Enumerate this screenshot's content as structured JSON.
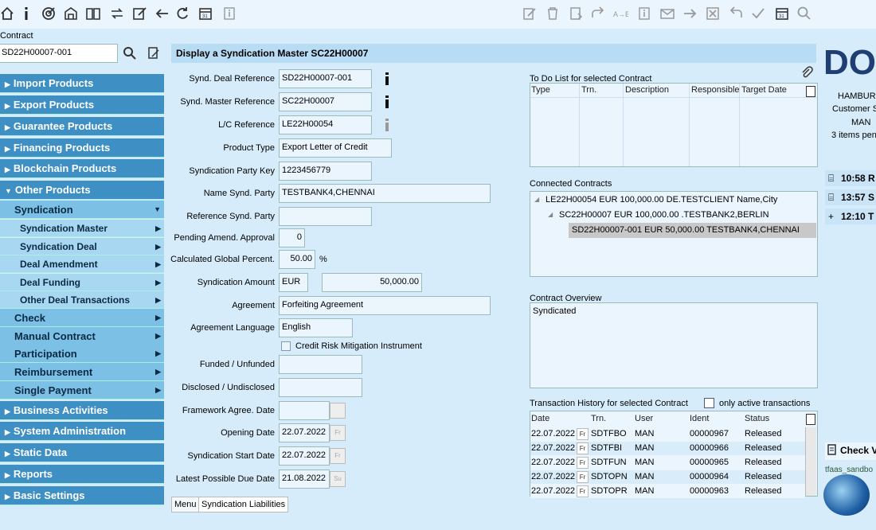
{
  "toolbar": {
    "left_icons": [
      "home-icon",
      "info-icon",
      "target-icon",
      "products-icon",
      "book-icon",
      "transfer-icon",
      "edit-icon",
      "back-arrow-icon",
      "refresh-icon",
      "calendar-icon",
      "info-box-icon"
    ],
    "right_icons": [
      "edit-doc-icon",
      "trash-icon",
      "attach-doc-icon",
      "forward-icon",
      "ab-icon",
      "info-box-icon",
      "mail-icon",
      "arrow-right-icon",
      "close-box-icon",
      "undo-icon",
      "check-icon",
      "calendar-icon",
      "search-icon"
    ]
  },
  "contract": {
    "label": "Contract",
    "value": "SD22H00007-001"
  },
  "nav": [
    {
      "label": "Import Products",
      "level": 0
    },
    {
      "label": "Export Products",
      "level": 0
    },
    {
      "label": "Guarantee Products",
      "level": 0
    },
    {
      "label": "Financing Products",
      "level": 0
    },
    {
      "label": "Blockchain Products",
      "level": 0
    },
    {
      "label": "Other Products",
      "level": 0,
      "open": true
    },
    {
      "label": "Syndication",
      "level": 1,
      "open": true
    },
    {
      "label": "Syndication Master",
      "level": 2
    },
    {
      "label": "Syndication Deal",
      "level": 2
    },
    {
      "label": "Deal Amendment",
      "level": 2
    },
    {
      "label": "Deal Funding",
      "level": 2
    },
    {
      "label": "Other Deal Transactions",
      "level": 2
    },
    {
      "label": "Check",
      "level": 1
    },
    {
      "label": "Manual Contract",
      "level": 1
    },
    {
      "label": "Participation",
      "level": 1
    },
    {
      "label": "Reimbursement",
      "level": 1
    },
    {
      "label": "Single Payment",
      "level": 1
    },
    {
      "label": "Business Activities",
      "level": 0
    },
    {
      "label": "System Administration",
      "level": 0
    },
    {
      "label": "Static Data",
      "level": 0
    },
    {
      "label": "Reports",
      "level": 0
    },
    {
      "label": "Basic Settings",
      "level": 0
    }
  ],
  "title": "Display a Syndication Master SC22H00007",
  "form": {
    "synd_deal_ref": {
      "label": "Synd. Deal Reference",
      "value": "SD22H00007-001"
    },
    "synd_master_ref": {
      "label": "Synd. Master Reference",
      "value": "SC22H00007"
    },
    "lc_ref": {
      "label": "L/C Reference",
      "value": "LE22H00054"
    },
    "product_type": {
      "label": "Product Type",
      "value": "Export Letter of Credit"
    },
    "party_key": {
      "label": "Syndication Party Key",
      "value": "1223456779"
    },
    "party_name": {
      "label": "Name Synd. Party",
      "value": "TESTBANK4,CHENNAI"
    },
    "reference": {
      "label": "Reference Synd. Party",
      "value": ""
    },
    "pending": {
      "label": "Pending Amend. Approval",
      "value": "0"
    },
    "percent": {
      "label": "Calculated Global Percent.",
      "value": "50.00",
      "unit": "%"
    },
    "amount": {
      "label": "Syndication Amount",
      "currency": "EUR",
      "value": "50,000.00"
    },
    "agreement": {
      "label": "Agreement",
      "value": "Forfeiting Agreement"
    },
    "language": {
      "label": "Agreement Language",
      "value": "English"
    },
    "crm": {
      "label": "Credit Risk Mitigation Instrument"
    },
    "funded": {
      "label": "Funded / Unfunded",
      "value": ""
    },
    "disclosed": {
      "label": "Disclosed / Undisclosed",
      "value": ""
    },
    "framework": {
      "label": "Framework Agree. Date",
      "value": ""
    },
    "opening": {
      "label": "Opening Date",
      "value": "22.07.2022",
      "cal": "Fr"
    },
    "start": {
      "label": "Syndication Start Date",
      "value": "22.07.2022",
      "cal": "Fr"
    },
    "due": {
      "label": "Latest Possible Due Date",
      "value": "21.08.2022",
      "cal": "Su"
    }
  },
  "todo": {
    "title": "To Do List for selected Contract",
    "columns": [
      "Type",
      "Trn.",
      "Description",
      "Responsible",
      "Target Date"
    ]
  },
  "connected": {
    "title": "Connected Contracts",
    "items": [
      "LE22H00054 EUR 100,000.00 DE.TESTCLIENT Name,City",
      "SC22H00007 EUR 100,000.00 .TESTBANK2,BERLIN",
      "SD22H00007-001 EUR 50,000.00 TESTBANK4,CHENNAI"
    ]
  },
  "overview": {
    "title": "Contract Overview",
    "text": "Syndicated"
  },
  "history": {
    "title": "Transaction History for selected Contract",
    "only_active": "only active transactions",
    "columns": [
      "Date",
      "Trn.",
      "User",
      "Ident",
      "Status"
    ],
    "rows": [
      {
        "date": "22.07.2022",
        "day": "Fr",
        "trn": "SDTFBO",
        "user": "MAN",
        "ident": "00000967",
        "status": "Released"
      },
      {
        "date": "22.07.2022",
        "day": "Fr",
        "trn": "SDTFBI",
        "user": "MAN",
        "ident": "00000966",
        "status": "Released"
      },
      {
        "date": "22.07.2022",
        "day": "Fr",
        "trn": "SDTFUN",
        "user": "MAN",
        "ident": "00000965",
        "status": "Released"
      },
      {
        "date": "22.07.2022",
        "day": "Fr",
        "trn": "SDTOPN",
        "user": "MAN",
        "ident": "00000964",
        "status": "Released"
      },
      {
        "date": "22.07.2022",
        "day": "Fr",
        "trn": "SDTOPR",
        "user": "MAN",
        "ident": "00000963",
        "status": "Released"
      }
    ]
  },
  "tabs": [
    "Menu",
    "Syndication Liabilities"
  ],
  "right": {
    "logo": "DO",
    "city": "HAMBUR",
    "customer": "Customer S",
    "user": "MAN",
    "pending": "3 items pen",
    "times": [
      "10:58 R",
      "13:57 S",
      "12:10 T"
    ],
    "check": "Check V",
    "sandbox": "tfaas_sandbo"
  }
}
